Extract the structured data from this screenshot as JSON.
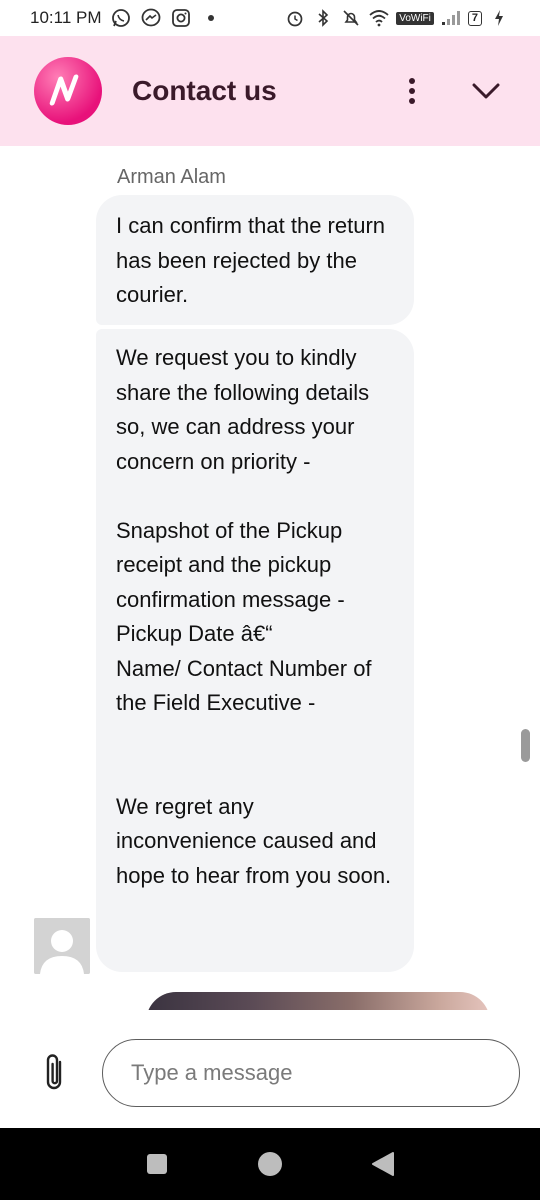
{
  "status_bar": {
    "time": "10:11 PM",
    "left_icons": [
      "whatsapp-icon",
      "messenger-icon",
      "instagram-icon",
      "dot-icon"
    ],
    "right_icons": [
      "alarm-icon",
      "bluetooth-icon",
      "mute-icon",
      "wifi-icon"
    ],
    "vowifi_label": "VoWiFi",
    "battery_level": "7"
  },
  "header": {
    "logo_letter": "N",
    "title": "Contact us",
    "accent_color": "#fde1ee"
  },
  "chat": {
    "sender_name": "Arman Alam",
    "messages": [
      {
        "text": "I can confirm that the return has been rejected by the courier."
      },
      {
        "text": "We request you to kindly share the following details so, we can address your concern on priority -\n\nSnapshot of the Pickup receipt and the pickup confirmation message - Pickup Date â€“\nName/ Contact Number of the Field Executive -\n\n\nWe regret any inconvenience caused and hope to hear from you soon."
      }
    ]
  },
  "composer": {
    "placeholder": "Type a message"
  },
  "nav_bar": {
    "buttons": [
      "recents-button",
      "home-button",
      "back-button"
    ]
  }
}
